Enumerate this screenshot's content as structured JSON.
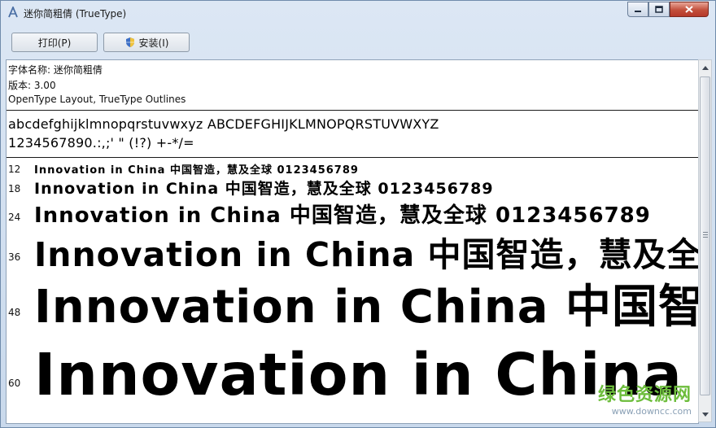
{
  "window": {
    "title": "迷你简粗倩 (TrueType)",
    "controls": {
      "minimize": "minimize",
      "maximize": "maximize",
      "close": "close"
    }
  },
  "toolbar": {
    "print_label": "打印(P)",
    "install_label": "安装(I)"
  },
  "info": {
    "font_name": "字体名称: 迷你简粗倩",
    "version": "版本: 3.00",
    "outline": "OpenType Layout, TrueType Outlines"
  },
  "charset": {
    "letters": "abcdefghijklmnopqrstuvwxyz ABCDEFGHIJKLMNOPQRSTUVWXYZ",
    "symbols": "1234567890.:,;' \" (!?) +-*/="
  },
  "samples": [
    {
      "size": "12",
      "text": "Innovation in China 中国智造，慧及全球 0123456789"
    },
    {
      "size": "18",
      "text": "Innovation in China 中国智造，慧及全球 0123456789"
    },
    {
      "size": "24",
      "text": "Innovation in China 中国智造，慧及全球 0123456789"
    },
    {
      "size": "36",
      "text": "Innovation in China 中国智造，慧及全"
    },
    {
      "size": "48",
      "text": "Innovation in China 中国智"
    },
    {
      "size": "60",
      "text": "Innovation in China 中"
    }
  ],
  "watermark": {
    "cn": "绿色资源网",
    "en": "www.downcc.com"
  },
  "colors": {
    "accent_green": "#6dbd3c",
    "close_red": "#c24f3b"
  }
}
